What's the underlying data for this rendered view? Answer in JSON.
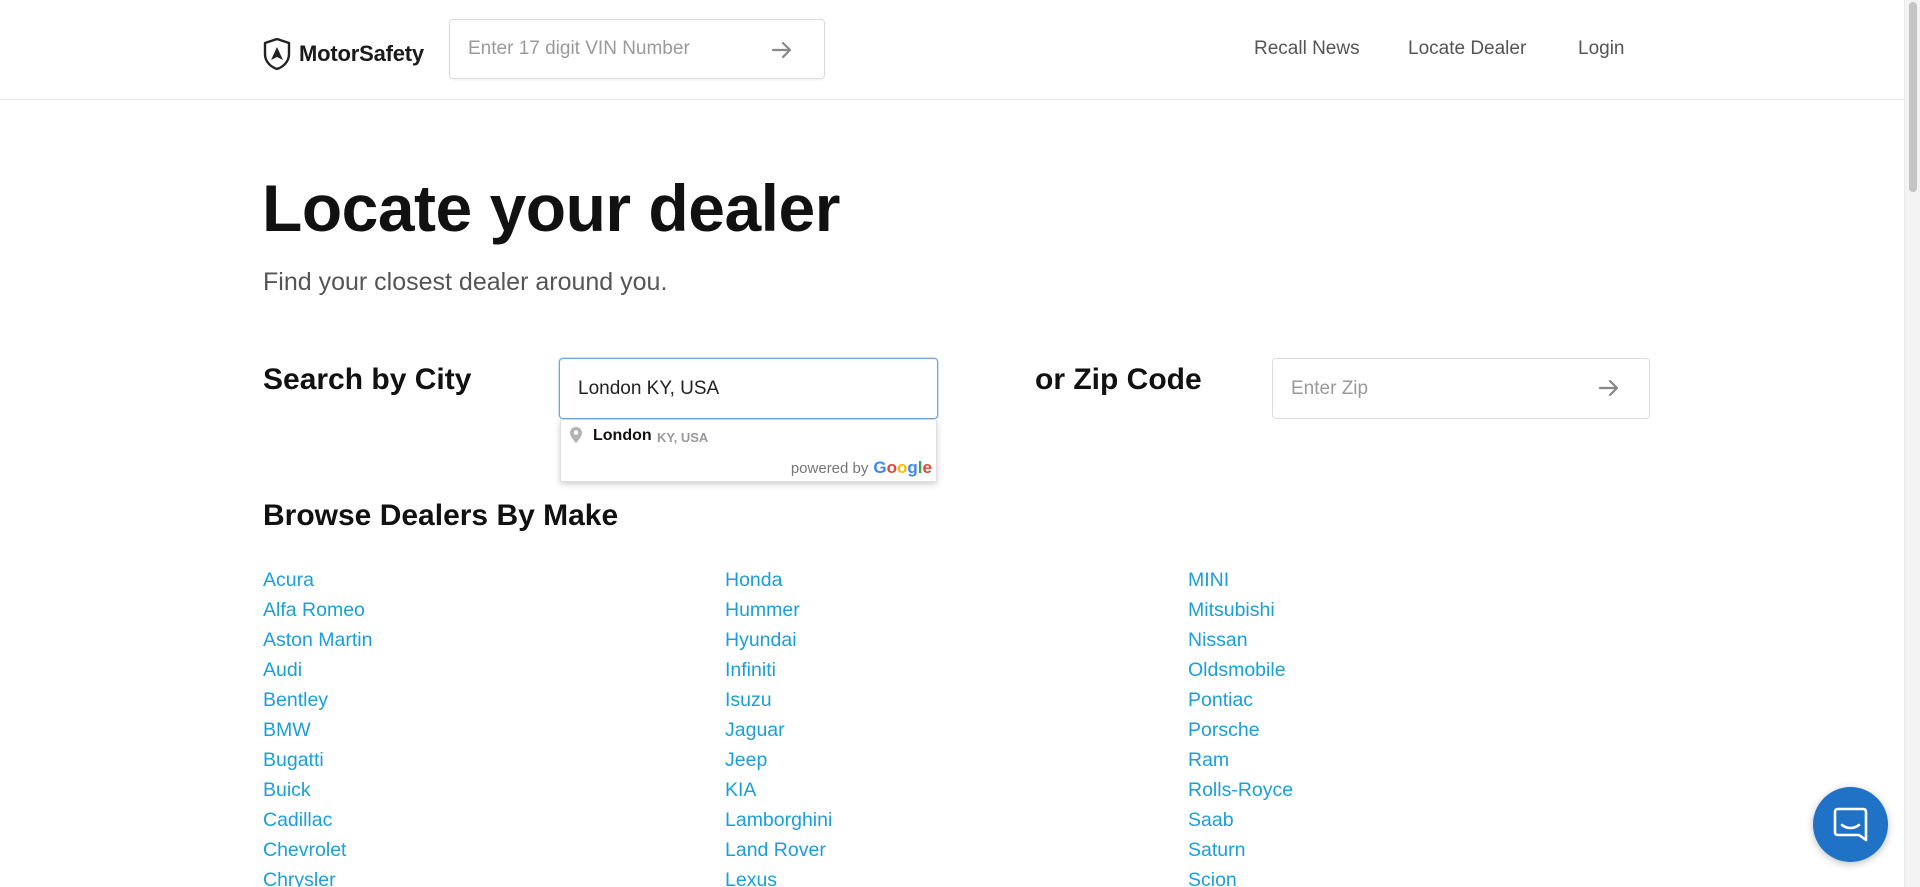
{
  "header": {
    "logo_text": "MotorSafety",
    "vin_placeholder": "Enter 17 digit VIN Number",
    "nav": {
      "recall_news": "Recall News",
      "locate_dealer": "Locate Dealer",
      "login": "Login"
    }
  },
  "hero": {
    "title": "Locate your dealer",
    "subtitle": "Find your closest dealer around you."
  },
  "search": {
    "city_label": "Search by City",
    "city_value": "London KY, USA",
    "zip_label": "or Zip Code",
    "zip_placeholder": "Enter Zip"
  },
  "autocomplete": {
    "main_text": "London",
    "secondary_text": "KY, USA",
    "powered_by": "powered by",
    "google_letters": [
      "G",
      "o",
      "o",
      "g",
      "l",
      "e"
    ]
  },
  "browse": {
    "title": "Browse Dealers By Make",
    "columns": [
      [
        "Acura",
        "Alfa Romeo",
        "Aston Martin",
        "Audi",
        "Bentley",
        "BMW",
        "Bugatti",
        "Buick",
        "Cadillac",
        "Chevrolet",
        "Chrysler"
      ],
      [
        "Honda",
        "Hummer",
        "Hyundai",
        "Infiniti",
        "Isuzu",
        "Jaguar",
        "Jeep",
        "KIA",
        "Lamborghini",
        "Land Rover",
        "Lexus"
      ],
      [
        "MINI",
        "Mitsubishi",
        "Nissan",
        "Oldsmobile",
        "Pontiac",
        "Porsche",
        "Ram",
        "Rolls-Royce",
        "Saab",
        "Saturn",
        "Scion"
      ]
    ]
  },
  "colors": {
    "link": "#1a9fd9",
    "chat_button": "#1f72c6",
    "focus_border": "#6fa8dc"
  },
  "icons": {
    "logo": "shield-logo-icon",
    "vin_submit": "arrow-right-icon",
    "zip_submit": "arrow-right-icon",
    "autocomplete": "map-pin-icon",
    "chat": "chat-bubble-icon"
  }
}
